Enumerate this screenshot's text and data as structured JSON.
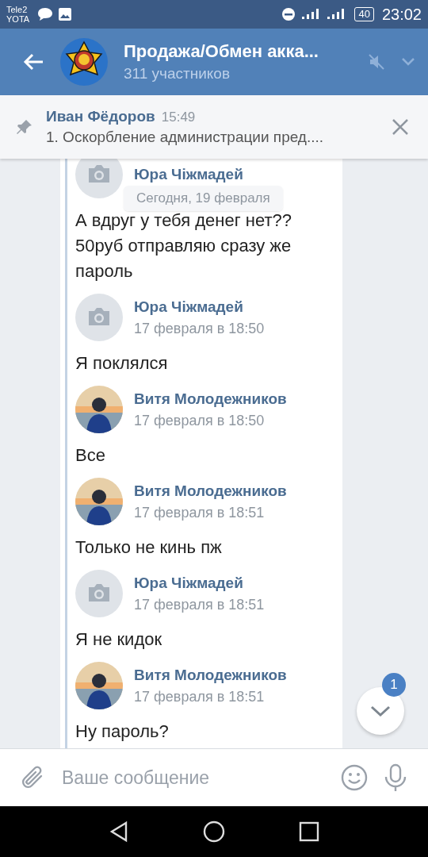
{
  "status_bar": {
    "carrier_1": "Tele2",
    "carrier_2": "YOTA",
    "battery": "40",
    "time": "23:02"
  },
  "header": {
    "title": "Продажа/Обмен акка...",
    "subtitle": "311 участников",
    "muted": true
  },
  "pinned": {
    "author": "Иван Фёдоров",
    "time": "15:49",
    "text": "1. Оскорбление администрации пред...."
  },
  "date_badge": "Сегодня, 19 февраля",
  "messages": [
    {
      "author": "Юра Чіжмадей",
      "kind": "camera",
      "text": "А вдруг у тебя денег нет?? 50руб отправляю сразу же пароль"
    },
    {
      "author": "Юра Чіжмадей",
      "kind": "camera",
      "date": "17 февраля в 18:50",
      "text": "Я поклялся"
    },
    {
      "author": "Витя Молодежников",
      "kind": "picture",
      "date": "17 февраля в 18:50",
      "text": "Все"
    },
    {
      "author": "Витя Молодежников",
      "kind": "picture",
      "date": "17 февраля в 18:51",
      "text": "Только не кинь пж"
    },
    {
      "author": "Юра Чіжмадей",
      "kind": "camera",
      "date": "17 февраля в 18:51",
      "text": "Я не кидок"
    },
    {
      "author": "Витя Молодежников",
      "kind": "picture",
      "date": "17 февраля в 18:51",
      "text": "Ну пароль?"
    }
  ],
  "scroll_button": {
    "badge": "1"
  },
  "composer": {
    "placeholder": "Ваше сообщение"
  }
}
